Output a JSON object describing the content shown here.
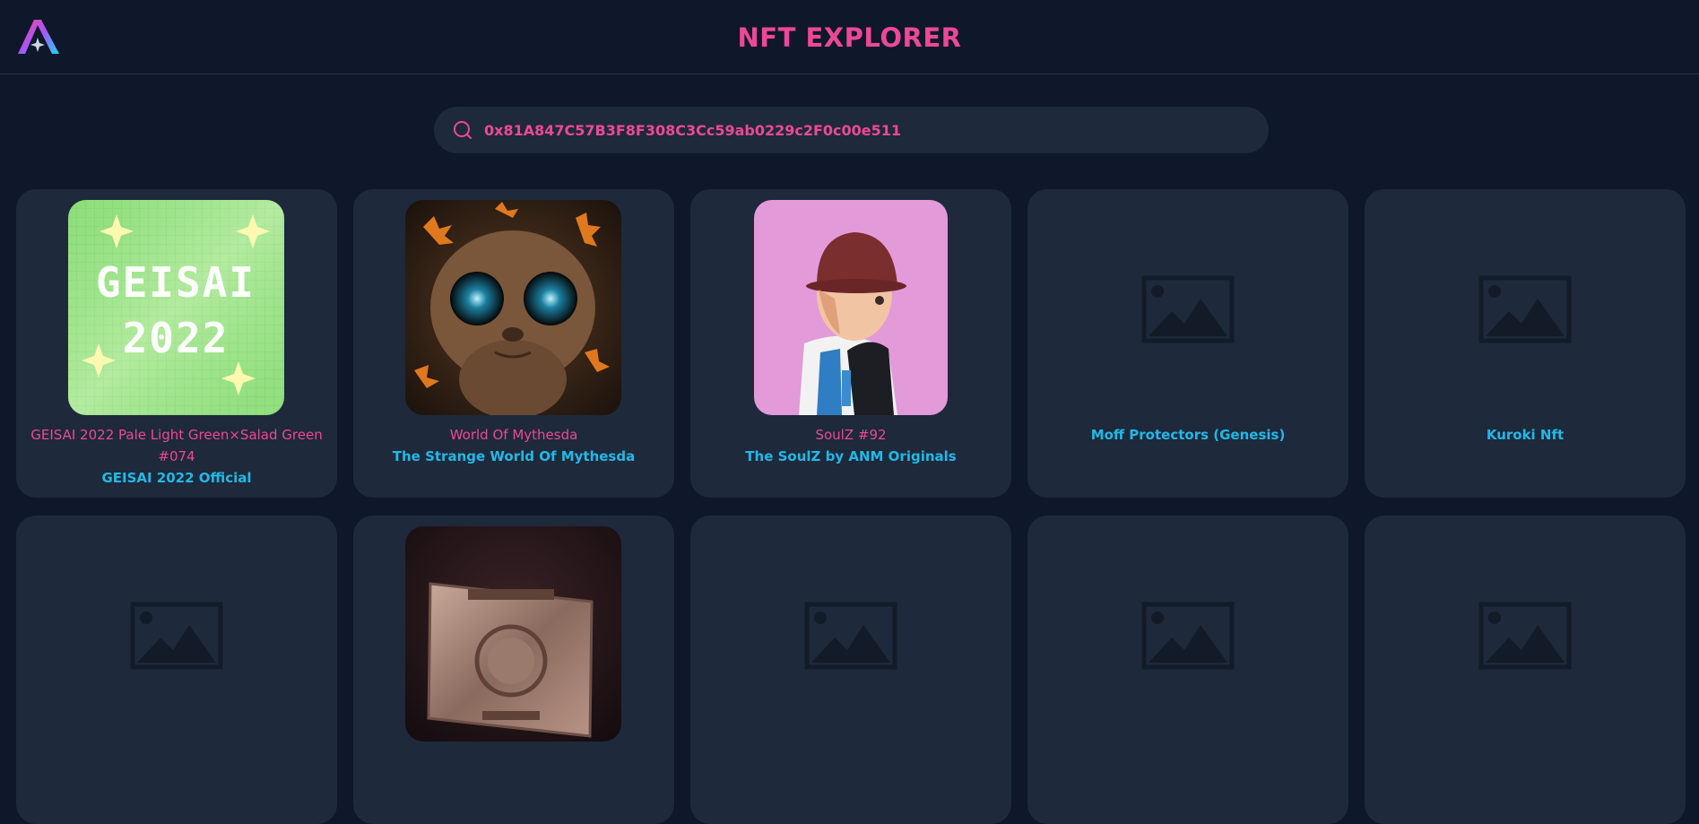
{
  "header": {
    "title": "NFT EXPLORER",
    "logo_icon": "app-logo-icon"
  },
  "search": {
    "value": "0x81A847C57B3F8F308C3Cc59ab0229c2F0c00e511",
    "icon": "search-icon"
  },
  "colors": {
    "background": "#0f172a",
    "card": "#1e293b",
    "accent_pink": "#ec4899",
    "accent_cyan": "#22b8e6"
  },
  "cards": [
    {
      "name": "GEISAI 2022 Pale Light Green×Salad Green #074",
      "collection": "GEISAI 2022 Official",
      "image": "pixel-art-geisai-2022"
    },
    {
      "name": "World Of Mythesda",
      "collection": "The Strange World Of Mythesda",
      "image": "wooden-creature"
    },
    {
      "name": "SoulZ #92",
      "collection": "The SoulZ by ANM Originals",
      "image": "anime-character-bucket-hat"
    },
    {
      "name": "",
      "collection": "Moff Protectors (Genesis)",
      "image": "image-placeholder-icon"
    },
    {
      "name": "",
      "collection": "Kuroki Nft",
      "image": "image-placeholder-icon"
    },
    {
      "name": "",
      "collection": "",
      "image": "image-placeholder-icon"
    },
    {
      "name": "",
      "collection": "",
      "image": "metal-member-card"
    },
    {
      "name": "",
      "collection": "",
      "image": "image-placeholder-icon"
    },
    {
      "name": "",
      "collection": "",
      "image": "image-placeholder-icon"
    },
    {
      "name": "",
      "collection": "",
      "image": "image-placeholder-icon"
    }
  ]
}
